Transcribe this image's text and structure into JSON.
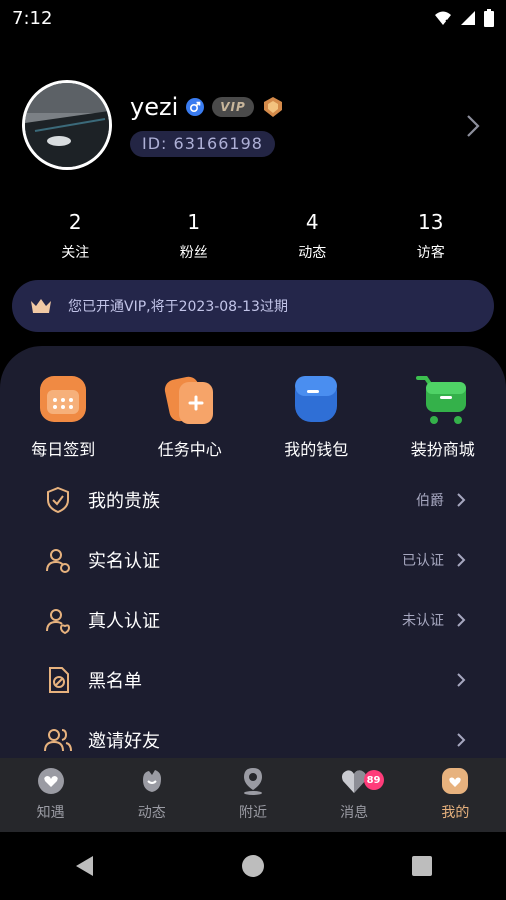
{
  "status_bar": {
    "time": "7:12",
    "icons": [
      "wifi-icon",
      "signal-icon",
      "battery-icon"
    ]
  },
  "profile": {
    "username": "yezi",
    "gender": "male",
    "vip_label": "VIP",
    "id_text": "ID: 63166198"
  },
  "stats": [
    {
      "value": "2",
      "label": "关注"
    },
    {
      "value": "1",
      "label": "粉丝"
    },
    {
      "value": "4",
      "label": "动态"
    },
    {
      "value": "13",
      "label": "访客"
    }
  ],
  "vip_banner": {
    "text": "您已开通VIP,将于2023-08-13过期"
  },
  "quick_actions": [
    {
      "label": "每日签到",
      "icon": "calendar-icon"
    },
    {
      "label": "任务中心",
      "icon": "task-icon"
    },
    {
      "label": "我的钱包",
      "icon": "wallet-icon"
    },
    {
      "label": "装扮商城",
      "icon": "cart-icon"
    }
  ],
  "menu": [
    {
      "label": "我的贵族",
      "status": "伯爵",
      "icon": "noble-shield-icon"
    },
    {
      "label": "实名认证",
      "status": "已认证",
      "icon": "id-verify-icon"
    },
    {
      "label": "真人认证",
      "status": "未认证",
      "icon": "face-verify-icon"
    },
    {
      "label": "黑名单",
      "status": "",
      "icon": "blacklist-icon"
    },
    {
      "label": "邀请好友",
      "status": "",
      "icon": "invite-friends-icon"
    }
  ],
  "tabs": [
    {
      "label": "知遇",
      "icon": "heart-tab-icon",
      "active": false
    },
    {
      "label": "动态",
      "icon": "fist-tab-icon",
      "active": false
    },
    {
      "label": "附近",
      "icon": "location-tab-icon",
      "active": false
    },
    {
      "label": "消息",
      "icon": "message-tab-icon",
      "active": false,
      "badge": "89"
    },
    {
      "label": "我的",
      "icon": "profile-tab-icon",
      "active": true
    }
  ],
  "colors": {
    "accent": "#e7b27e",
    "panel": "#1c1d2f",
    "vip_banner": "#24264a",
    "badge": "#ff3c7a"
  }
}
